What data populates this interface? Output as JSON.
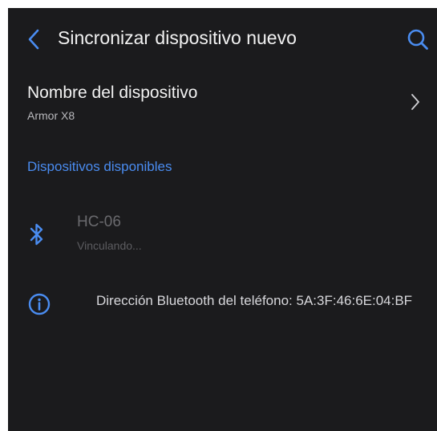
{
  "header": {
    "title": "Sincronizar dispositivo nuevo",
    "back_icon": "chevron-left-icon",
    "search_icon": "search-icon"
  },
  "device_name": {
    "label": "Nombre del dispositivo",
    "value": "Armor X8",
    "chevron_icon": "chevron-right-icon"
  },
  "available_devices": {
    "section_title": "Dispositivos disponibles",
    "items": [
      {
        "name": "HC-06",
        "status": "Vinculando...",
        "icon": "bluetooth-icon"
      }
    ]
  },
  "info": {
    "icon": "info-icon",
    "text": "Dirección Bluetooth del teléfono: 5A:3F:46:6E:04:BF"
  },
  "colors": {
    "background": "#1b1b1d",
    "accent": "#4a8cf0",
    "text_primary": "#f2f2f2",
    "text_secondary": "#b9b9bd",
    "text_disabled": "#6a6a6e"
  }
}
